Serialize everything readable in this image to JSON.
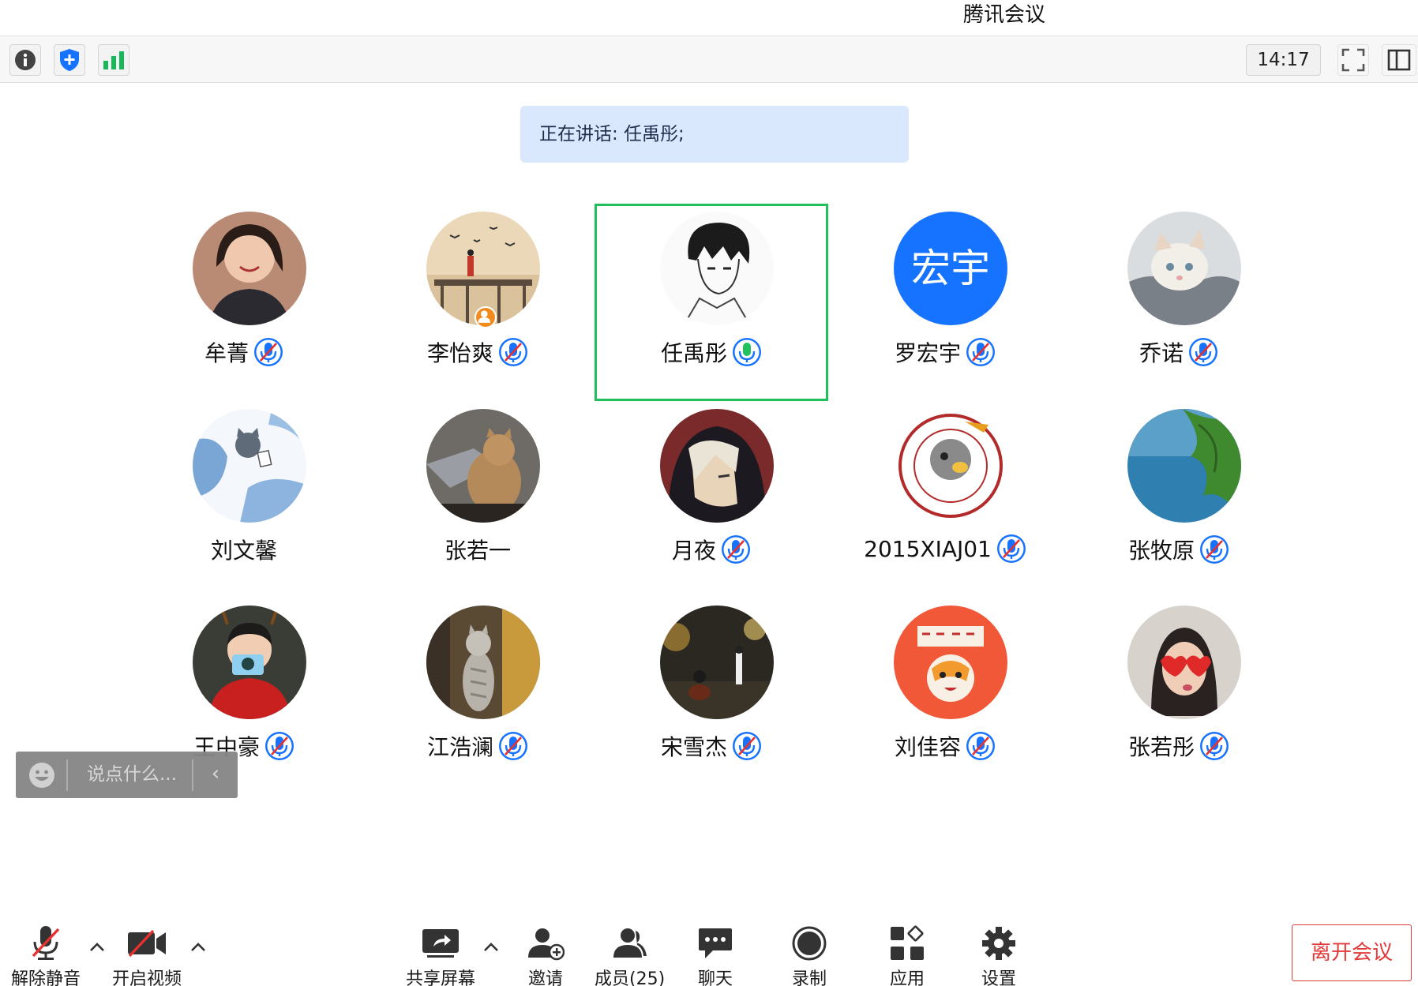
{
  "window": {
    "title": "腾讯会议"
  },
  "toolbar": {
    "info_icon": "info-icon",
    "security_icon": "shield-plus-icon",
    "signal_icon": "signal-bars-icon",
    "time": "14:17",
    "fullscreen_icon": "fullscreen-icon",
    "layout_icon": "layout-panel-icon"
  },
  "speaking": {
    "text": "正在讲话: 任禹彤;"
  },
  "colors": {
    "accent": "#1673ff",
    "active_border": "#20c05c",
    "speaking_bg": "#d9e8fd",
    "leave": "#e03a3a"
  },
  "participants": [
    {
      "name": "牟菁",
      "mic": "muted",
      "avatar": "photo-girl-smiling"
    },
    {
      "name": "李怡爽",
      "mic": "muted",
      "avatar": "art-pier-birds",
      "badge": "host-icon"
    },
    {
      "name": "任禹彤",
      "mic": "speaking",
      "avatar": "sketch-anime-boy",
      "active": true
    },
    {
      "name": "罗宏宇",
      "mic": "muted",
      "avatar": "text-avatar",
      "avatar_text": "宏宇"
    },
    {
      "name": "乔诺",
      "mic": "muted",
      "avatar": "photo-cat-blanket"
    },
    {
      "name": "刘文馨",
      "mic": "none",
      "avatar": "art-sky-cat"
    },
    {
      "name": "张若一",
      "mic": "none",
      "avatar": "photo-cat-desk"
    },
    {
      "name": "月夜",
      "mic": "muted",
      "avatar": "art-anime-hood"
    },
    {
      "name": "2015XIAJ01",
      "mic": "muted",
      "avatar": "logo-university"
    },
    {
      "name": "张牧原",
      "mic": "muted",
      "avatar": "photo-tree-lake"
    },
    {
      "name": "王中豪",
      "mic": "muted",
      "avatar": "photo-camera-girl"
    },
    {
      "name": "江浩澜",
      "mic": "muted",
      "avatar": "photo-cat-standing"
    },
    {
      "name": "宋雪杰",
      "mic": "muted",
      "avatar": "photo-night-street"
    },
    {
      "name": "刘佳容",
      "mic": "muted",
      "avatar": "art-tiger-new-year"
    },
    {
      "name": "张若彤",
      "mic": "muted",
      "avatar": "photo-girl-heart-glasses"
    }
  ],
  "chat": {
    "placeholder": "说点什么...",
    "emoji_icon": "emoji-icon",
    "collapse_icon": "chevron-left-icon"
  },
  "bottombar": {
    "unmute_label": "解除静音",
    "video_label": "开启视频",
    "share_label": "共享屏幕",
    "invite_label": "邀请",
    "members_label": "成员(25)",
    "chat_label": "聊天",
    "record_label": "录制",
    "apps_label": "应用",
    "settings_label": "设置",
    "leave_label": "离开会议"
  }
}
